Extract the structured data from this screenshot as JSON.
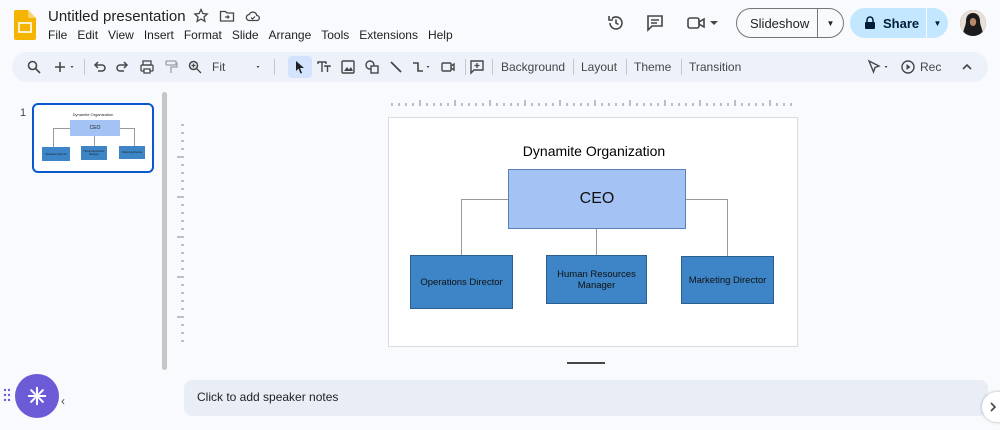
{
  "app": {
    "title": "Untitled presentation",
    "menu": [
      "File",
      "Edit",
      "View",
      "Insert",
      "Format",
      "Slide",
      "Arrange",
      "Tools",
      "Extensions",
      "Help"
    ]
  },
  "header": {
    "slideshow_label": "Slideshow",
    "share_label": "Share"
  },
  "toolbar": {
    "zoom_label": "Fit",
    "background_label": "Background",
    "layout_label": "Layout",
    "theme_label": "Theme",
    "transition_label": "Transition",
    "rec_label": "Rec"
  },
  "filmstrip": {
    "slide_number": "1",
    "thumb_title": "Dynamite Organization",
    "thumb_ceo": "CEO"
  },
  "slide": {
    "title": "Dynamite Organization",
    "ceo_label": "CEO",
    "children": [
      "Operations Director",
      "Human Resources Manager",
      "Marketing Director"
    ]
  },
  "notes": {
    "placeholder": "Click to add speaker notes"
  },
  "colors": {
    "ceo_fill": "#a4c2f4",
    "child_fill": "#3d85c6",
    "accent": "#0b57d0",
    "share_bg": "#c2e7ff"
  }
}
